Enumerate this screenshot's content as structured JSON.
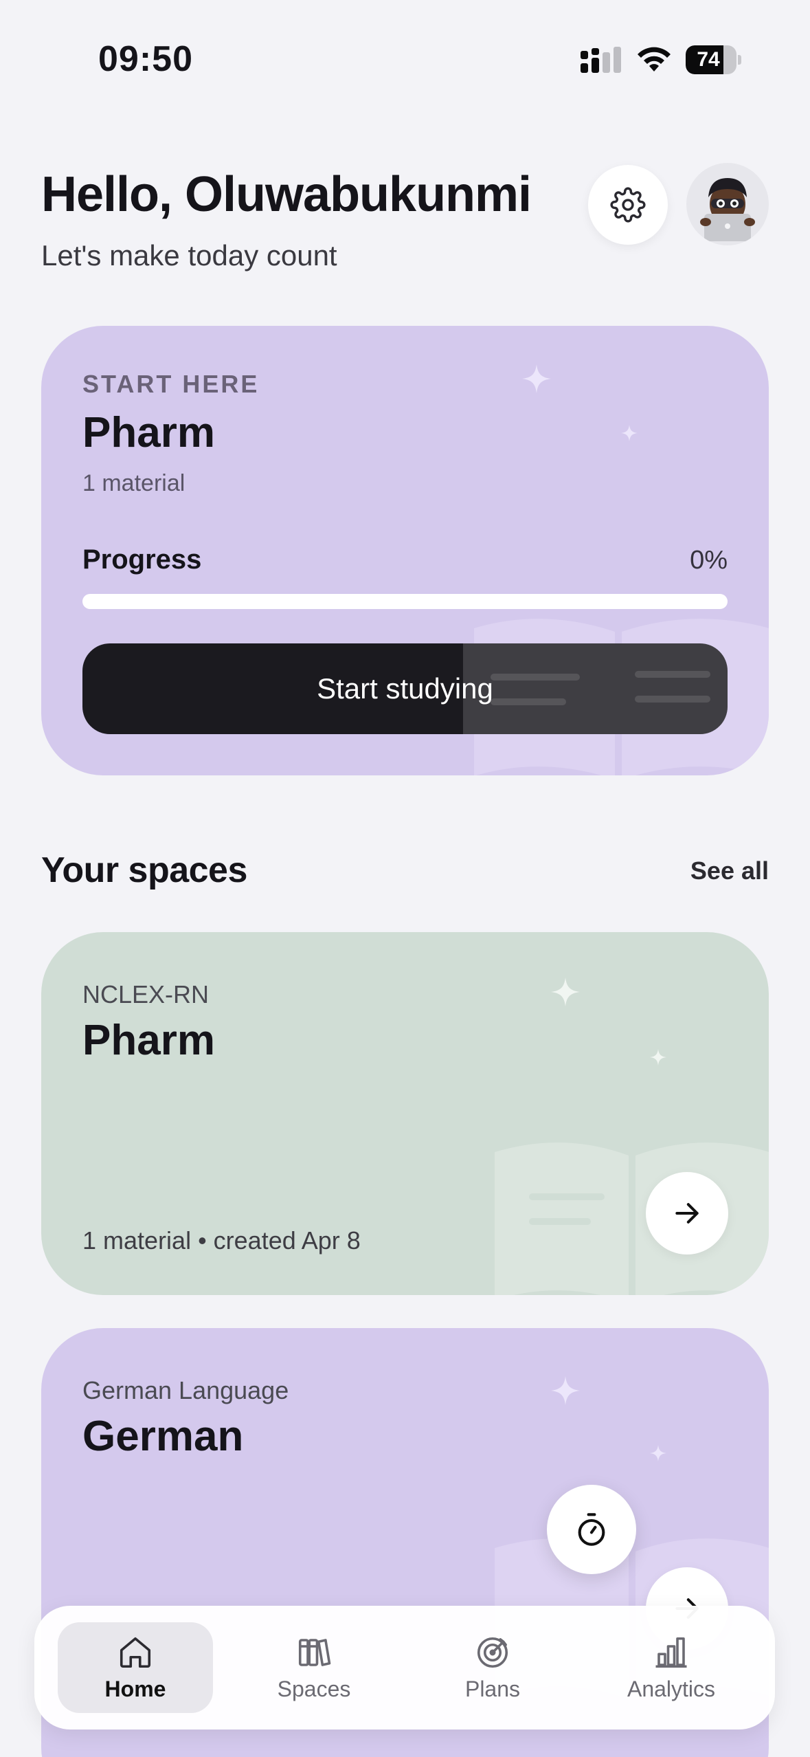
{
  "status_bar": {
    "time": "09:50",
    "battery": "74",
    "battery_level": 0.74
  },
  "header": {
    "greeting": "Hello, Oluwabukunmi",
    "subtitle": "Let's make today count"
  },
  "hero": {
    "eyebrow": "START HERE",
    "title": "Pharm",
    "meta": "1 material",
    "progress_label": "Progress",
    "progress_value": "0%",
    "progress_fraction": 0,
    "button_label": "Start studying"
  },
  "spaces": {
    "title": "Your spaces",
    "see_all": "See all",
    "items": [
      {
        "eyebrow": "NCLEX-RN",
        "title": "Pharm",
        "meta": "1 material • created Apr 8",
        "color": "#d0ddd5"
      },
      {
        "eyebrow": "German Language",
        "title": "German",
        "meta": "",
        "color": "#d4c9ed"
      }
    ]
  },
  "tab_bar": {
    "items": [
      {
        "label": "Home",
        "icon": "home-icon",
        "active": true
      },
      {
        "label": "Spaces",
        "icon": "books-icon",
        "active": false
      },
      {
        "label": "Plans",
        "icon": "target-icon",
        "active": false
      },
      {
        "label": "Analytics",
        "icon": "bar-chart-icon",
        "active": false
      }
    ]
  },
  "colors": {
    "background": "#f3f3f7",
    "accent_purple": "#d4c9ed",
    "accent_green": "#d0ddd5",
    "button_dark": "#1b1a1f"
  }
}
